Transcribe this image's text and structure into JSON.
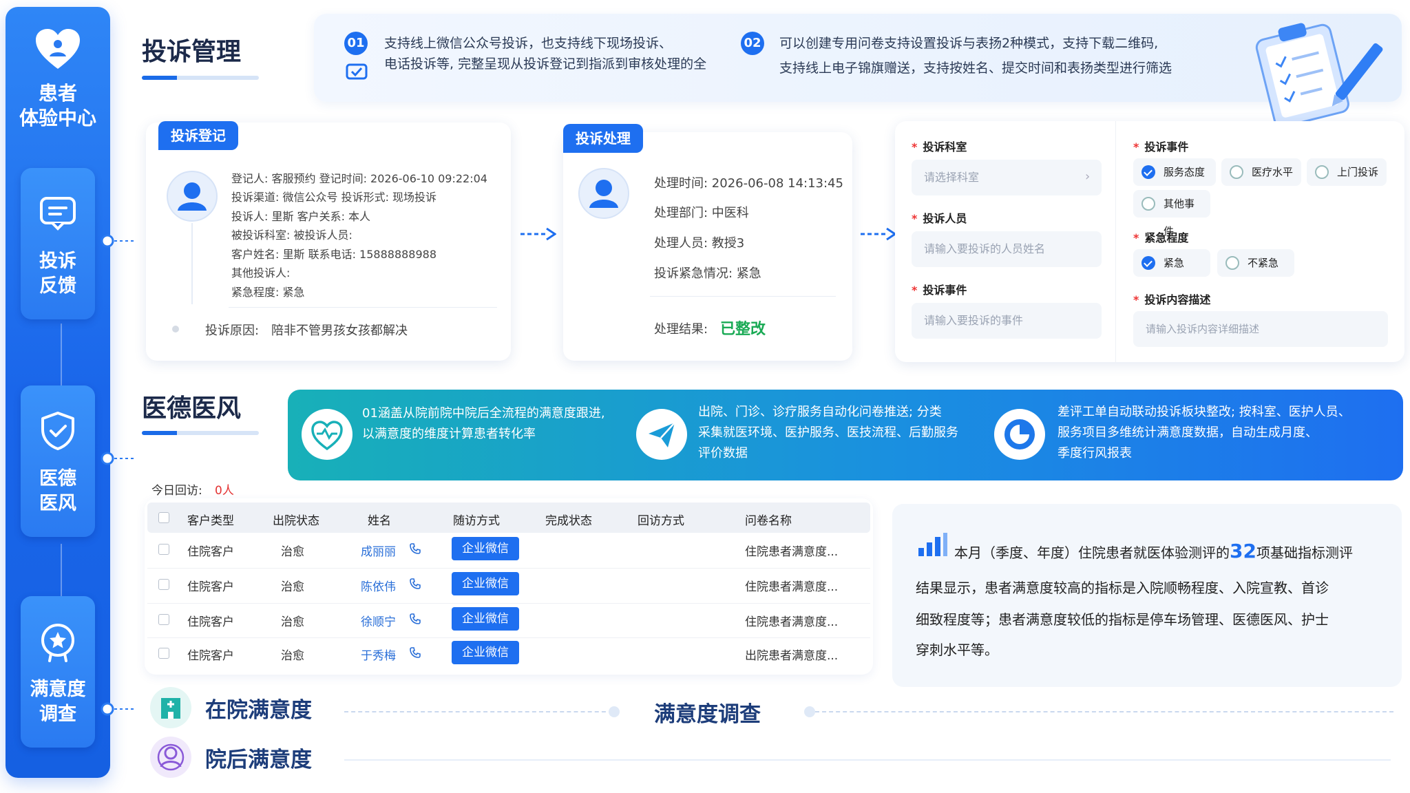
{
  "sidebar": {
    "title_line1": "患者",
    "title_line2": "体验中心",
    "items": [
      {
        "line1": "投诉",
        "line2": "反馈"
      },
      {
        "line1": "医德",
        "line2": "医风"
      },
      {
        "line1": "满意度",
        "line2": "调查"
      }
    ]
  },
  "complaint": {
    "title": "投诉管理",
    "banner": {
      "n1": "01",
      "t1a": "支持线上微信公众号投诉，也支持线下现场投诉、",
      "t1b": "电话投诉等, 完整呈现从投诉登记到指派到审核处理的全",
      "n2": "02",
      "t2a": "可以创建专用问卷支持设置投诉与表扬2种模式，支持下载二维码,",
      "t2b": "支持线上电子锦旗赠送，支持按姓名、提交时间和表扬类型进行筛选"
    },
    "register": {
      "tag": "投诉登记",
      "l1": "登记人:   客服预约    登记时间:   2026-06-10 09:22:04",
      "l2": "投诉渠道:   微信公众号     投诉形式:   现场投诉",
      "l3": "投诉人:     里斯    客户关系:   本人",
      "l4": "被投诉科室:    被投诉人员:",
      "l5": "客户姓名:     里斯     联系电话:    15888888988",
      "l6": "其他投诉人:",
      "l7": "紧急程度:     紧急",
      "reason_label": "投诉原因:",
      "reason": "陪非不管男孩女孩都解决"
    },
    "process": {
      "tag": "投诉处理",
      "l1": "处理时间:   2026-06-08 14:13:45",
      "l2": "处理部门:   中医科",
      "l3": "处理人员:   教授3",
      "l4": "投诉紧急情况:    紧急",
      "result_label": "处理结果:",
      "result": "已整改"
    },
    "form": {
      "dept_label": "投诉科室",
      "dept_placeholder": "请选择科室",
      "person_label": "投诉人员",
      "person_placeholder": "请输入要投诉的人员姓名",
      "event_label": "投诉事件",
      "event_placeholder": "请输入要投诉的事件",
      "event_type_label": "投诉事件",
      "event_options": [
        "服务态度",
        "医疗水平",
        "上门投诉",
        "其他事件"
      ],
      "urgency_label": "紧急程度",
      "urgency_options": [
        "紧急",
        "不紧急"
      ],
      "desc_label": "投诉内容描述",
      "desc_placeholder": "请输入投诉内容详细描述"
    }
  },
  "ethics": {
    "title": "医德医风",
    "r1a": "01涵盖从院前院中院后全流程的满意度跟进,",
    "r1b": "以满意度的维度计算患者转化率",
    "r2a": "出院、门诊、诊疗服务自动化问卷推送; 分类",
    "r2b": "采集就医环境、医护服务、医技流程、后勤服务",
    "r2c": "评价数据",
    "r3a": "差评工单自动联动投诉板块整改; 按科室、医护人员、",
    "r3b": "服务项目多维统计满意度数据，自动生成月度、",
    "r3c": "季度行风报表"
  },
  "followup": {
    "today_label": "今日回访:",
    "today_count": "0人",
    "headers": [
      "客户类型",
      "出院状态",
      "姓名",
      "随访方式",
      "完成状态",
      "回访方式",
      "问卷名称"
    ],
    "rows": [
      {
        "type": "住院客户",
        "status": "治愈",
        "name": "成丽丽",
        "method": "企业微信",
        "survey": "住院患者满意度..."
      },
      {
        "type": "住院客户",
        "status": "治愈",
        "name": "陈依伟",
        "method": "企业微信",
        "survey": "住院患者满意度..."
      },
      {
        "type": "住院客户",
        "status": "治愈",
        "name": "徐顺宁",
        "method": "企业微信",
        "survey": "住院患者满意度..."
      },
      {
        "type": "住院客户",
        "status": "治愈",
        "name": "于秀梅",
        "method": "企业微信",
        "survey": "出院患者满意度..."
      }
    ]
  },
  "satisfaction": {
    "p1a": "本月（季度、年度）住院患者就医体验测评的",
    "p1num": "32",
    "p1b": "项基础指标测评",
    "p2": "结果显示，患者满意度较高的指标是入院顺畅程度、入院宣教、首诊",
    "p3": "细致程度等；患者满意度较低的指标是停车场管理、医德医风、护士",
    "p4": "穿刺水平等。",
    "in_hospital": "在院满意度",
    "after_hospital": "院后满意度",
    "survey_title": "满意度调查"
  },
  "colors": {
    "primary": "#1e6ff0",
    "success": "#1aaa55",
    "danger": "#e33333"
  }
}
